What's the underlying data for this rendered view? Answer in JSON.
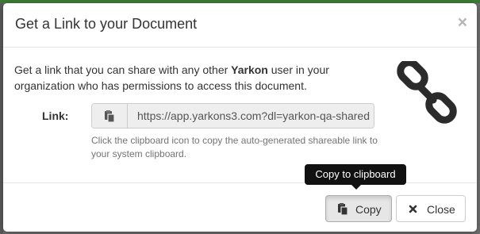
{
  "modal": {
    "title": "Get a Link to your Document",
    "close_glyph": "×"
  },
  "body": {
    "description_start": "Get a link that you can share with any other ",
    "description_brand": "Yarkon",
    "description_end": " user in your organization who has permissions to access this document.",
    "link_label": "Link:",
    "link_value": "https://app.yarkons3.com?dl=yarkon-qa-shared",
    "help_text": "Click the clipboard icon to copy the auto-generated shareable link to your system clipboard."
  },
  "footer": {
    "copy_label": "Copy",
    "close_label": "Close"
  },
  "tooltip": {
    "text": "Copy to clipboard"
  },
  "icons": {
    "chain": "chain-link-icon",
    "clipboard": "clipboard-icon",
    "close": "x-icon"
  },
  "colors": {
    "top_strip": "#3d7a36",
    "chain_icon": "#2b2b2b",
    "tooltip_bg": "#111111"
  }
}
